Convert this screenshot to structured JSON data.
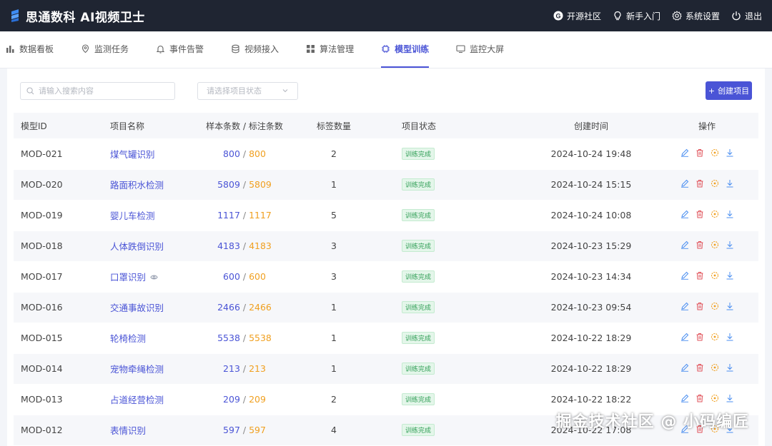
{
  "app": {
    "title": "思通数科 AI视频卫士"
  },
  "header_actions": [
    {
      "label": "开源社区",
      "icon": "github-icon"
    },
    {
      "label": "新手入门",
      "icon": "lightbulb-icon"
    },
    {
      "label": "系统设置",
      "icon": "gear-icon"
    },
    {
      "label": "退出",
      "icon": "power-icon"
    }
  ],
  "nav": [
    {
      "label": "数据看板",
      "icon": "bar-chart-icon",
      "active": false
    },
    {
      "label": "监测任务",
      "icon": "location-icon",
      "active": false
    },
    {
      "label": "事件告警",
      "icon": "bell-icon",
      "active": false
    },
    {
      "label": "视频接入",
      "icon": "database-icon",
      "active": false
    },
    {
      "label": "算法管理",
      "icon": "grid-icon",
      "active": false
    },
    {
      "label": "模型训练",
      "icon": "chip-icon",
      "active": true
    },
    {
      "label": "监控大屏",
      "icon": "monitor-icon",
      "active": false
    }
  ],
  "toolbar": {
    "search_placeholder": "请输入搜索内容",
    "status_placeholder": "请选择项目状态",
    "create_label": "创建项目"
  },
  "table": {
    "headers": [
      "模型ID",
      "项目名称",
      "样本条数 / 标注条数",
      "标签数量",
      "项目状态",
      "创建时间",
      "操作"
    ],
    "rows": [
      {
        "id": "MOD-021",
        "name": "煤气罐识别",
        "samples": "800",
        "labeled": "800",
        "tags": "2",
        "status": "训练完成",
        "time": "2024-10-24 19:48"
      },
      {
        "id": "MOD-020",
        "name": "路面积水检测",
        "samples": "5809",
        "labeled": "5809",
        "tags": "1",
        "status": "训练完成",
        "time": "2024-10-24 15:15"
      },
      {
        "id": "MOD-019",
        "name": "婴儿车检测",
        "samples": "1117",
        "labeled": "1117",
        "tags": "5",
        "status": "训练完成",
        "time": "2024-10-24 10:08"
      },
      {
        "id": "MOD-018",
        "name": "人体跌倒识别",
        "samples": "4183",
        "labeled": "4183",
        "tags": "3",
        "status": "训练完成",
        "time": "2024-10-23 15:29"
      },
      {
        "id": "MOD-017",
        "name": "口罩识别",
        "samples": "600",
        "labeled": "600",
        "tags": "3",
        "status": "训练完成",
        "time": "2024-10-23 14:34"
      },
      {
        "id": "MOD-016",
        "name": "交通事故识别",
        "samples": "2466",
        "labeled": "2466",
        "tags": "1",
        "status": "训练完成",
        "time": "2024-10-23 09:54"
      },
      {
        "id": "MOD-015",
        "name": "轮椅检测",
        "samples": "5538",
        "labeled": "5538",
        "tags": "1",
        "status": "训练完成",
        "time": "2024-10-22 18:29"
      },
      {
        "id": "MOD-014",
        "name": "宠物牵绳检测",
        "samples": "213",
        "labeled": "213",
        "tags": "1",
        "status": "训练完成",
        "time": "2024-10-22 18:29"
      },
      {
        "id": "MOD-013",
        "name": "占道经营检测",
        "samples": "209",
        "labeled": "209",
        "tags": "2",
        "status": "训练完成",
        "time": "2024-10-22 18:22"
      },
      {
        "id": "MOD-012",
        "name": "表情识别",
        "samples": "597",
        "labeled": "597",
        "tags": "4",
        "status": "训练完成",
        "time": "2024-10-22 17:08"
      }
    ]
  },
  "watermark": "掘金技术社区 @ 小码编匠",
  "colors": {
    "primary": "#4a54d6",
    "header_bg": "#1f2532",
    "warning": "#f0a020",
    "success": "#2f9e55",
    "danger": "#e0525a"
  }
}
